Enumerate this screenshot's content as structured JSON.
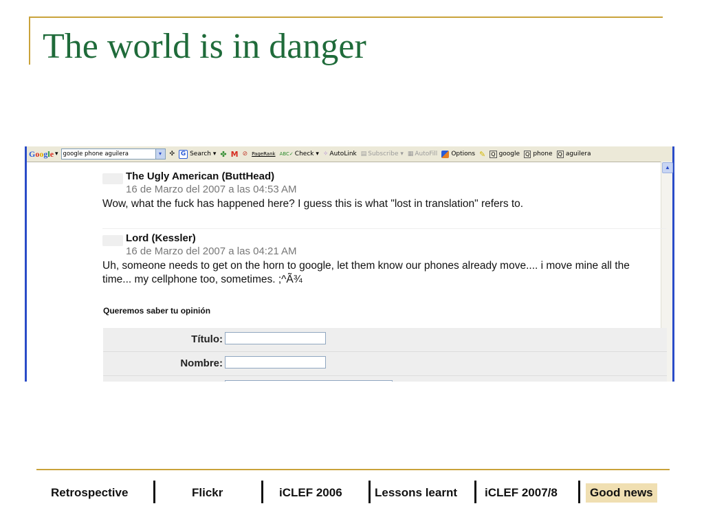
{
  "slide": {
    "title": "The world is in danger"
  },
  "toolbar": {
    "logo": "Google",
    "search_value": "google phone aguilera",
    "items": {
      "search": "Search",
      "pagerank": "PageRank",
      "check": "Check",
      "autolink": "AutoLink",
      "subscribe": "Subscribe",
      "autofill": "AutoFill",
      "options": "Options",
      "google": "google",
      "phone": "phone",
      "aguilera": "aguilera"
    }
  },
  "comments": [
    {
      "author": "The Ugly American (ButtHead)",
      "date": "16 de Marzo del 2007 a las 04:53 AM",
      "text": "Wow, what the fuck has happened here? I guess this is what \"lost in translation\" refers to."
    },
    {
      "author": "Lord (Kessler)",
      "date": "16 de Marzo del 2007 a las 04:21 AM",
      "text": "Uh, someone needs to get on the horn to google, let them know our phones already move.... i move mine all the time... my cellphone too, sometimes. ;^Ã¾"
    }
  ],
  "form": {
    "heading": "Queremos saber tu opinión",
    "titulo_label": "Título:",
    "nombre_label": "Nombre:"
  },
  "nav": {
    "items": [
      "Retrospective",
      "Flickr",
      "iCLEF 2006",
      "Lessons learnt",
      "iCLEF 2007/8",
      "Good news"
    ],
    "active": "Good news",
    "active_color": "#f0dfb2"
  },
  "colors": {
    "title": "#1f6b3a",
    "rules": "#c9a23a",
    "window_border": "#2a4cc8"
  }
}
